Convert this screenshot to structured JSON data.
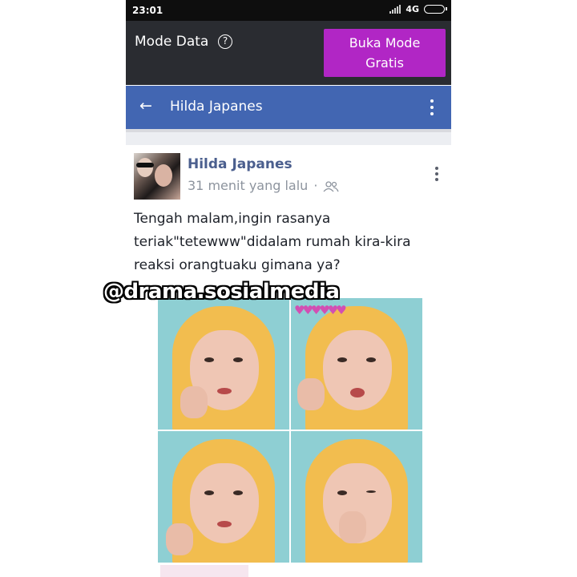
{
  "status_bar": {
    "time": "23:01",
    "network": "4G"
  },
  "data_mode_bar": {
    "label": "Mode Data",
    "help_icon": "question-circle-icon",
    "free_mode_button": "Buka Mode\nGratis",
    "button_color": "#b126c5"
  },
  "app_bar": {
    "back_icon": "arrow-left-icon",
    "title": "Hilda Japanes",
    "menu_icon": "vertical-dots-icon",
    "color": "#4266b2"
  },
  "post": {
    "author": "Hilda Japanes",
    "time": "31 menit yang lalu",
    "separator": "·",
    "audience_icon": "friends-icon",
    "menu_icon": "vertical-dots-icon",
    "text": "Tengah malam,ingin rasanya teriak\"tetewww\"didalam rumah kira-kira reaksi orangtuaku gimana ya?"
  },
  "watermark": "@drama.sosialmedia"
}
